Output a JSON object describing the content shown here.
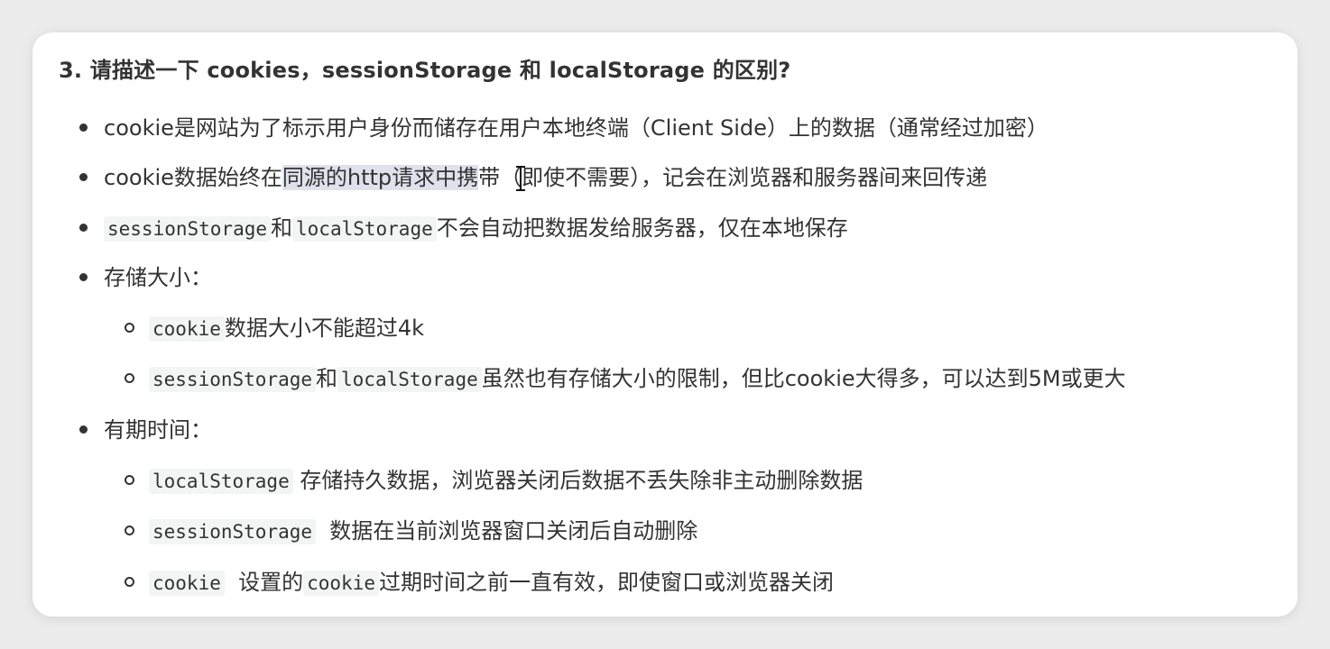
{
  "heading": "3. 请描述一下 cookies，sessionStorage 和 localStorage 的区别?",
  "items": {
    "i1": {
      "text": "cookie是网站为了标示用户身份而储存在用户本地终端（Client Side）上的数据（通常经过加密）"
    },
    "i2": {
      "a": "cookie数据始终在",
      "b": "同源的http请求中携",
      "c": "带（即使不需要），记会在浏览器和服务器间来回传递"
    },
    "i3": {
      "code1": "sessionStorage",
      "t1": "和",
      "code2": "localStorage",
      "t2": "不会自动把数据发给服务器，仅在本地保存"
    },
    "i4": {
      "text": "存储大小："
    },
    "i4a": {
      "code1": "cookie",
      "t1": "数据大小不能超过4k"
    },
    "i4b": {
      "code1": "sessionStorage",
      "t1": "和",
      "code2": "localStorage",
      "t2": "虽然也有存储大小的限制，但比cookie大得多，可以达到5M或更大"
    },
    "i5": {
      "text": "有期时间："
    },
    "i5a": {
      "code1": "localStorage",
      "t1": " 存储持久数据，浏览器关闭后数据不丢失除非主动删除数据"
    },
    "i5b": {
      "code1": "sessionStorage",
      "t1": "  数据在当前浏览器窗口关闭后自动删除"
    },
    "i5c": {
      "code1": "cookie",
      "t1": "  设置的",
      "code2": "cookie",
      "t2": "过期时间之前一直有效，即使窗口或浏览器关闭"
    }
  },
  "icons": {
    "cursor": "text-cursor-icon"
  },
  "colors": {
    "highlight": "#dfe2ec",
    "code_bg": "#f3f4f4",
    "text": "#333333"
  }
}
